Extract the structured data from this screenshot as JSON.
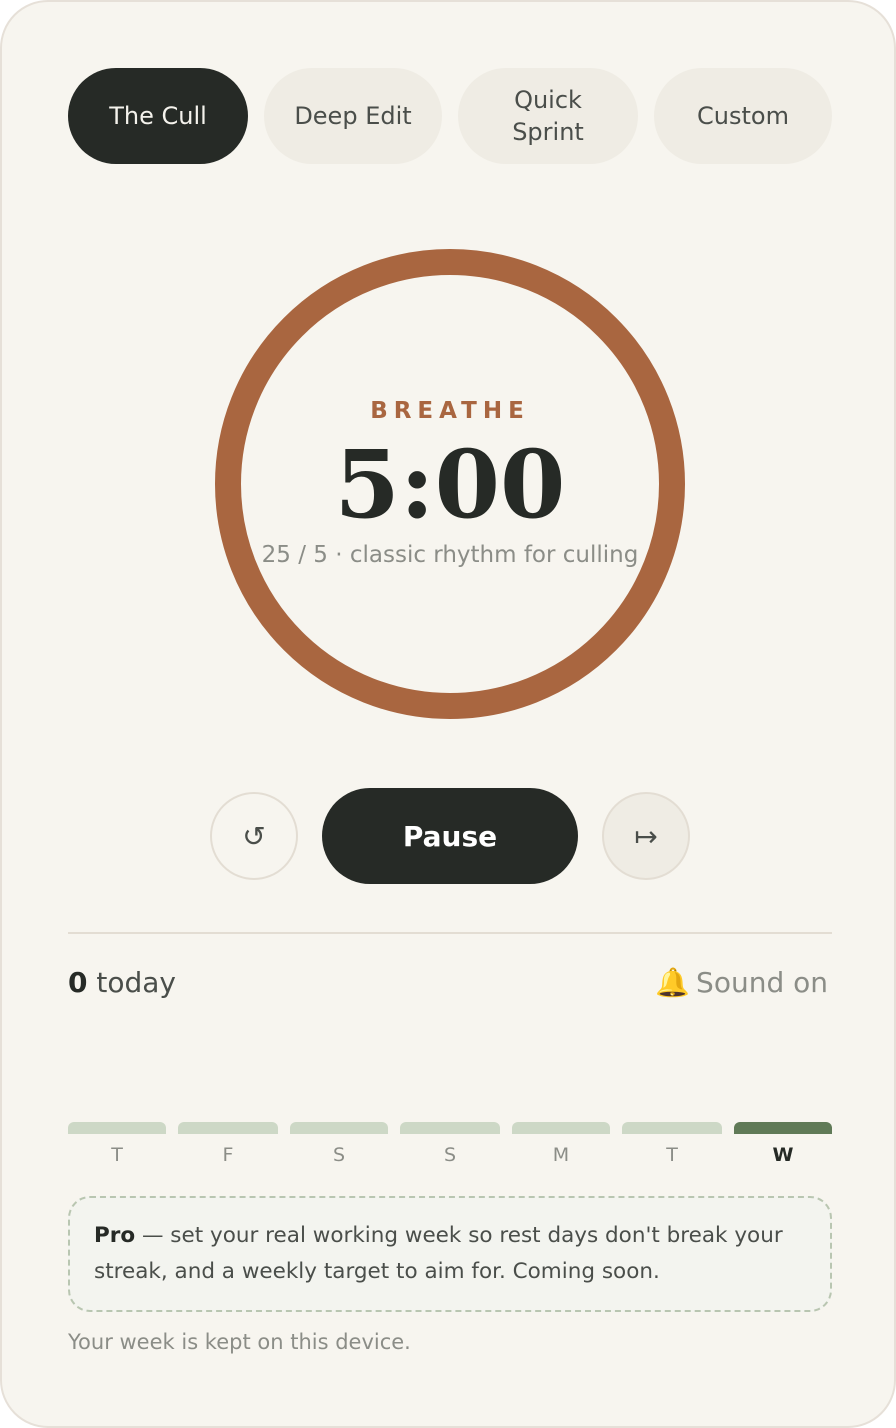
{
  "modes": [
    {
      "label": "The Cull",
      "active": true
    },
    {
      "label": "Deep Edit",
      "active": false
    },
    {
      "label": "Quick Sprint",
      "active": false
    },
    {
      "label": "Custom",
      "active": false
    }
  ],
  "timer": {
    "phase": "BREATHE",
    "time": "5:00",
    "subtitle": "25 / 5 · classic rhythm for culling",
    "ring_color": "#a96640"
  },
  "controls": {
    "reset_icon": "↺",
    "primary_label": "Pause",
    "skip_icon": "↦"
  },
  "stats": {
    "today_count": "0",
    "today_label": "today",
    "sound_icon": "🔔",
    "sound_label": "Sound on"
  },
  "week": {
    "days": [
      "T",
      "F",
      "S",
      "S",
      "M",
      "T",
      "W"
    ],
    "current_index": 6,
    "bar_color": "#cdd8c6",
    "current_bar_color": "#607a57"
  },
  "pro_note": {
    "tag": "Pro",
    "text": " — set your real working week so rest days don't break your streak, and a weekly target to aim for. Coming soon."
  },
  "footer": "Your week is kept on this device."
}
